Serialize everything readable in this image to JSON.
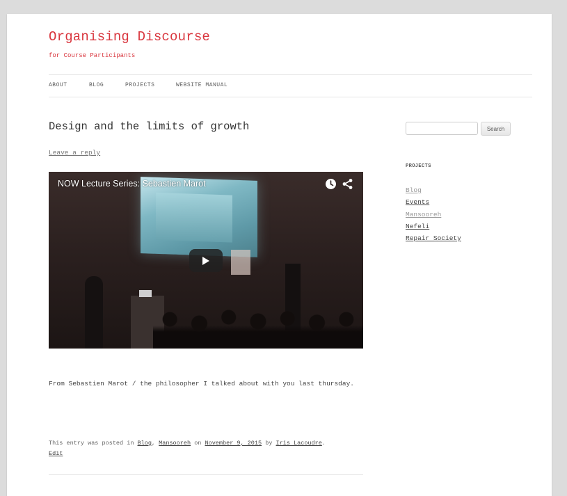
{
  "header": {
    "site_title": "Organising Discourse",
    "tagline": "for Course Participants"
  },
  "nav": {
    "items": [
      {
        "label": "ABOUT"
      },
      {
        "label": "BLOG"
      },
      {
        "label": "PROJECTS"
      },
      {
        "label": "WEBSITE MANUAL"
      }
    ]
  },
  "post": {
    "title": "Design and the limits of growth",
    "leave_reply": "Leave a reply",
    "video": {
      "title": "NOW Lecture Series: Sebastien Marot",
      "icons": [
        "watch-later-icon",
        "share-icon",
        "play-icon"
      ]
    },
    "body": "From Sebastien Marot / the philosopher I talked about with you last thursday.",
    "meta": {
      "prefix": "This entry was posted in",
      "category_1": "Blog",
      "separator": ",",
      "category_2": "Mansooreh",
      "on_text": "on",
      "date": "November 9, 2015",
      "by_text": "by",
      "author": "Iris Lacoudre",
      "period": ".",
      "edit": "Edit"
    }
  },
  "sidebar": {
    "search": {
      "placeholder": "",
      "button_label": "Search"
    },
    "widget_title": "PROJECTS",
    "links": [
      {
        "label": "Blog"
      },
      {
        "label": "Events"
      },
      {
        "label": "Mansooreh"
      },
      {
        "label": "Nefeli"
      },
      {
        "label": "Repair Society"
      }
    ]
  },
  "colors": {
    "brand_red": "#d9363e",
    "page_background": "#dcdcdc",
    "content_background": "#ffffff"
  }
}
